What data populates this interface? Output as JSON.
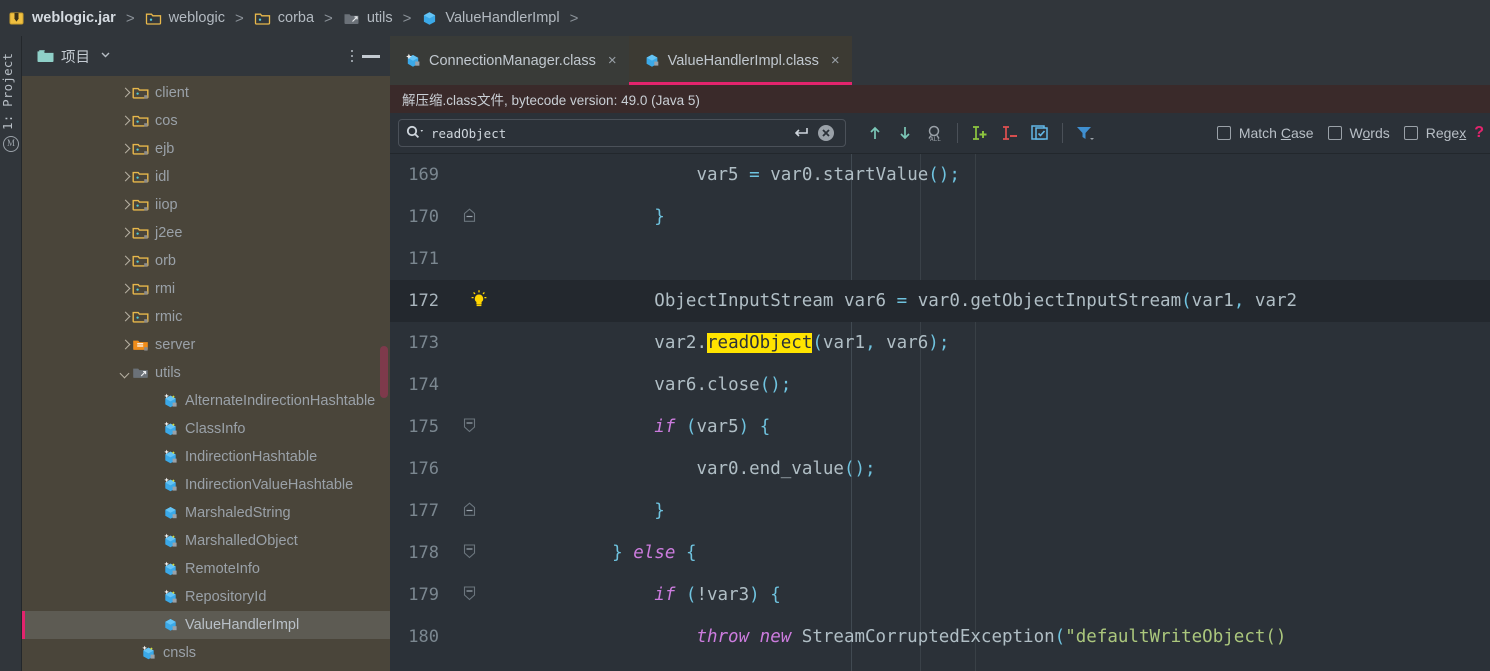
{
  "breadcrumb": {
    "items": [
      {
        "icon": "jar-icon",
        "label": "weblogic.jar",
        "bold": true
      },
      {
        "icon": "folder-icon",
        "label": "weblogic",
        "bold": false
      },
      {
        "icon": "folder-icon",
        "label": "corba",
        "bold": false
      },
      {
        "icon": "package-source-icon",
        "label": "utils",
        "bold": false
      },
      {
        "icon": "class-icon",
        "label": "ValueHandlerImpl",
        "bold": false
      }
    ],
    "separator": ">"
  },
  "toolstrip": {
    "project_tab": "1: Project",
    "maven_tab": "M"
  },
  "project_panel": {
    "title": "项目",
    "chevron": "chevron-down-icon",
    "options_icon": "more-options-icon",
    "minimize_icon": "minimize-icon",
    "tree": [
      {
        "label": "client",
        "icon": "folder-icon",
        "arrow": "right",
        "indent": 110,
        "selected": false
      },
      {
        "label": "cos",
        "icon": "folder-icon",
        "arrow": "right",
        "indent": 110,
        "selected": false
      },
      {
        "label": "ejb",
        "icon": "folder-icon",
        "arrow": "right",
        "indent": 110,
        "selected": false
      },
      {
        "label": "idl",
        "icon": "folder-icon",
        "arrow": "right",
        "indent": 110,
        "selected": false
      },
      {
        "label": "iiop",
        "icon": "folder-icon",
        "arrow": "right",
        "indent": 110,
        "selected": false
      },
      {
        "label": "j2ee",
        "icon": "folder-icon",
        "arrow": "right",
        "indent": 110,
        "selected": false
      },
      {
        "label": "orb",
        "icon": "folder-icon",
        "arrow": "right",
        "indent": 110,
        "selected": false
      },
      {
        "label": "rmi",
        "icon": "folder-icon",
        "arrow": "right",
        "indent": 110,
        "selected": false
      },
      {
        "label": "rmic",
        "icon": "folder-icon",
        "arrow": "right",
        "indent": 110,
        "selected": false
      },
      {
        "label": "server",
        "icon": "folder-orange-icon",
        "arrow": "right",
        "indent": 110,
        "selected": false
      },
      {
        "label": "utils",
        "icon": "package-source-icon",
        "arrow": "down",
        "indent": 110,
        "selected": false
      },
      {
        "label": "AlternateIndirectionHashtable",
        "icon": "class-decompiled-icon",
        "arrow": "none",
        "indent": 140,
        "selected": false
      },
      {
        "label": "ClassInfo",
        "icon": "class-decompiled-icon",
        "arrow": "none",
        "indent": 140,
        "selected": false
      },
      {
        "label": "IndirectionHashtable",
        "icon": "class-decompiled-icon",
        "arrow": "none",
        "indent": 140,
        "selected": false
      },
      {
        "label": "IndirectionValueHashtable",
        "icon": "class-decompiled-icon",
        "arrow": "none",
        "indent": 140,
        "selected": false
      },
      {
        "label": "MarshaledString",
        "icon": "class-icon",
        "arrow": "none",
        "indent": 140,
        "selected": false
      },
      {
        "label": "MarshalledObject",
        "icon": "class-decompiled-icon",
        "arrow": "none",
        "indent": 140,
        "selected": false
      },
      {
        "label": "RemoteInfo",
        "icon": "class-decompiled-icon",
        "arrow": "none",
        "indent": 140,
        "selected": false
      },
      {
        "label": "RepositoryId",
        "icon": "class-decompiled-icon",
        "arrow": "none",
        "indent": 140,
        "selected": false
      },
      {
        "label": "ValueHandlerImpl",
        "icon": "class-icon",
        "arrow": "none",
        "indent": 140,
        "selected": true
      },
      {
        "label": "cnsls",
        "icon": "class-decompiled-icon",
        "arrow": "none",
        "indent": 118,
        "selected": false
      }
    ]
  },
  "editor": {
    "tabs": [
      {
        "label": "ConnectionManager.class",
        "icon": "class-decompiled-icon",
        "active": false,
        "close": "×"
      },
      {
        "label": "ValueHandlerImpl.class",
        "icon": "class-icon",
        "active": true,
        "close": "×"
      }
    ],
    "notification": "解压缩.class文件, bytecode version: 49.0 (Java 5)"
  },
  "find": {
    "search_icon": "search-icon",
    "dropdown_icon": "chevron-down-icon",
    "value": "readObject",
    "placeholder": "",
    "enter_icon": "enter-icon",
    "clear_icon": "clear-circle-icon",
    "buttons": [
      {
        "name": "find-previous-button",
        "icon": "arrow-up-icon"
      },
      {
        "name": "find-next-button",
        "icon": "arrow-down-icon"
      },
      {
        "name": "find-all-button",
        "icon": "find-all-icon"
      },
      {
        "name": "add-selection-next-button",
        "icon": "add-selection-icon"
      },
      {
        "name": "remove-selection-button",
        "icon": "remove-selection-icon"
      },
      {
        "name": "select-all-occurrences-button",
        "icon": "select-all-icon"
      },
      {
        "name": "filter-button",
        "icon": "filter-icon"
      }
    ],
    "checkboxes": [
      {
        "label_pre": "Match ",
        "label_mnemonic": "C",
        "label_post": "ase",
        "checked": false,
        "name": "match-case-checkbox"
      },
      {
        "label_pre": "W",
        "label_mnemonic": "o",
        "label_post": "rds",
        "checked": false,
        "name": "words-checkbox"
      },
      {
        "label_pre": "Rege",
        "label_mnemonic": "x",
        "label_post": "",
        "checked": false,
        "name": "regex-checkbox"
      }
    ],
    "help": "?"
  },
  "code": {
    "lines": [
      {
        "num": "169",
        "current": false,
        "fold": "none",
        "bulb": false,
        "tokens": [
          {
            "t": "            ",
            "c": "id"
          },
          {
            "t": "var5 ",
            "c": "id"
          },
          {
            "t": "=",
            "c": "p"
          },
          {
            "t": " var0",
            "c": "id"
          },
          {
            "t": ".",
            "c": "id"
          },
          {
            "t": "startValue",
            "c": "id"
          },
          {
            "t": "();",
            "c": "p"
          }
        ]
      },
      {
        "num": "170",
        "current": false,
        "fold": "end",
        "bulb": false,
        "tokens": [
          {
            "t": "        ",
            "c": "id"
          },
          {
            "t": "}",
            "c": "p"
          }
        ]
      },
      {
        "num": "171",
        "current": false,
        "fold": "none",
        "bulb": false,
        "tokens": []
      },
      {
        "num": "172",
        "current": true,
        "fold": "none",
        "bulb": true,
        "tokens": [
          {
            "t": "        ",
            "c": "id"
          },
          {
            "t": "ObjectInputStream var6 ",
            "c": "id"
          },
          {
            "t": "=",
            "c": "p"
          },
          {
            "t": " var0",
            "c": "id"
          },
          {
            "t": ".",
            "c": "id"
          },
          {
            "t": "getObjectInputStream",
            "c": "id"
          },
          {
            "t": "(",
            "c": "p"
          },
          {
            "t": "var1",
            "c": "id"
          },
          {
            "t": ", ",
            "c": "p"
          },
          {
            "t": "var2",
            "c": "id"
          }
        ]
      },
      {
        "num": "173",
        "current": false,
        "fold": "none",
        "bulb": false,
        "tokens": [
          {
            "t": "        ",
            "c": "id"
          },
          {
            "t": "var2",
            "c": "id"
          },
          {
            "t": ".",
            "c": "id"
          },
          {
            "t": "readObject",
            "c": "hl"
          },
          {
            "t": "(",
            "c": "p"
          },
          {
            "t": "var1",
            "c": "id"
          },
          {
            "t": ", ",
            "c": "p"
          },
          {
            "t": "var6",
            "c": "id"
          },
          {
            "t": ");",
            "c": "p"
          }
        ]
      },
      {
        "num": "174",
        "current": false,
        "fold": "none",
        "bulb": false,
        "tokens": [
          {
            "t": "        ",
            "c": "id"
          },
          {
            "t": "var6",
            "c": "id"
          },
          {
            "t": ".",
            "c": "id"
          },
          {
            "t": "close",
            "c": "id"
          },
          {
            "t": "();",
            "c": "p"
          }
        ]
      },
      {
        "num": "175",
        "current": false,
        "fold": "start",
        "bulb": false,
        "tokens": [
          {
            "t": "        ",
            "c": "id"
          },
          {
            "t": "if",
            "c": "k"
          },
          {
            "t": " ",
            "c": "id"
          },
          {
            "t": "(",
            "c": "p"
          },
          {
            "t": "var5",
            "c": "id"
          },
          {
            "t": ") {",
            "c": "p"
          }
        ]
      },
      {
        "num": "176",
        "current": false,
        "fold": "none",
        "bulb": false,
        "tokens": [
          {
            "t": "            ",
            "c": "id"
          },
          {
            "t": "var0",
            "c": "id"
          },
          {
            "t": ".",
            "c": "id"
          },
          {
            "t": "end_value",
            "c": "id"
          },
          {
            "t": "();",
            "c": "p"
          }
        ]
      },
      {
        "num": "177",
        "current": false,
        "fold": "end",
        "bulb": false,
        "tokens": [
          {
            "t": "        ",
            "c": "id"
          },
          {
            "t": "}",
            "c": "p"
          }
        ]
      },
      {
        "num": "178",
        "current": false,
        "fold": "start",
        "bulb": false,
        "tokens": [
          {
            "t": "    ",
            "c": "id"
          },
          {
            "t": "}",
            "c": "p"
          },
          {
            "t": " ",
            "c": "id"
          },
          {
            "t": "else",
            "c": "k"
          },
          {
            "t": " ",
            "c": "id"
          },
          {
            "t": "{",
            "c": "p"
          }
        ]
      },
      {
        "num": "179",
        "current": false,
        "fold": "start",
        "bulb": false,
        "tokens": [
          {
            "t": "        ",
            "c": "id"
          },
          {
            "t": "if",
            "c": "k"
          },
          {
            "t": " ",
            "c": "id"
          },
          {
            "t": "(",
            "c": "p"
          },
          {
            "t": "!var3",
            "c": "id"
          },
          {
            "t": ") {",
            "c": "p"
          }
        ]
      },
      {
        "num": "180",
        "current": false,
        "fold": "none",
        "bulb": false,
        "tokens": [
          {
            "t": "            ",
            "c": "id"
          },
          {
            "t": "throw new",
            "c": "k"
          },
          {
            "t": " StreamCorruptedException",
            "c": "id"
          },
          {
            "t": "(",
            "c": "p"
          },
          {
            "t": "\"defaultWriteObject()",
            "c": "s"
          }
        ]
      }
    ]
  },
  "colors": {
    "accent_pink": "#e2246d",
    "highlight_yellow": "#ffe400",
    "editor_bg": "#2b3138",
    "panel_bg": "#4a453a",
    "chrome_bg": "#31363b"
  }
}
